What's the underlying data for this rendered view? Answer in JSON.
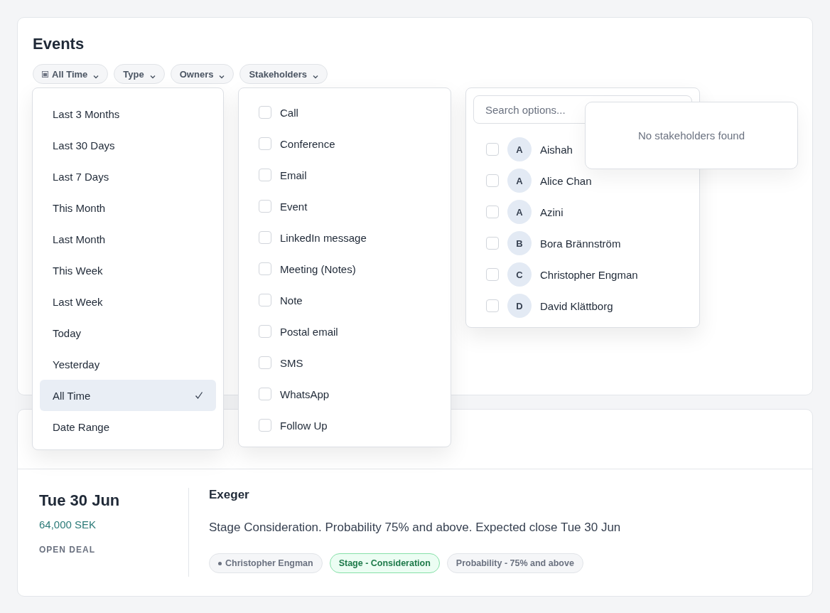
{
  "title": "Events",
  "filters": [
    {
      "label": "All Time",
      "kind": "date"
    },
    {
      "label": "Type",
      "kind": "plain"
    },
    {
      "label": "Owners",
      "kind": "plain"
    },
    {
      "label": "Stakeholders",
      "kind": "plain"
    }
  ],
  "time_menu": {
    "options": [
      {
        "label": "Last 3 Months",
        "selected": false
      },
      {
        "label": "Last 30 Days",
        "selected": false
      },
      {
        "label": "Last 7 Days",
        "selected": false
      },
      {
        "label": "This Month",
        "selected": false
      },
      {
        "label": "Last Month",
        "selected": false
      },
      {
        "label": "This Week",
        "selected": false
      },
      {
        "label": "Last Week",
        "selected": false
      },
      {
        "label": "Today",
        "selected": false
      },
      {
        "label": "Yesterday",
        "selected": false
      },
      {
        "label": "All Time",
        "selected": true
      },
      {
        "label": "Date Range",
        "selected": false
      }
    ]
  },
  "type_menu": {
    "options": [
      {
        "label": "Call",
        "checked": false
      },
      {
        "label": "Conference",
        "checked": false
      },
      {
        "label": "Email",
        "checked": false
      },
      {
        "label": "Event",
        "checked": false
      },
      {
        "label": "LinkedIn message",
        "checked": false
      },
      {
        "label": "Meeting (Notes)",
        "checked": false
      },
      {
        "label": "Note",
        "checked": false
      },
      {
        "label": "Postal email",
        "checked": false
      },
      {
        "label": "SMS",
        "checked": false
      },
      {
        "label": "WhatsApp",
        "checked": false
      },
      {
        "label": "Follow Up",
        "checked": false
      }
    ]
  },
  "stakeholder_menu": {
    "search": {
      "placeholder": "Search options..."
    },
    "options": [
      {
        "initial": "A",
        "name": "Aishah",
        "checked": false
      },
      {
        "initial": "A",
        "name": "Alice Chan",
        "checked": false
      },
      {
        "initial": "A",
        "name": "Azini",
        "checked": false
      },
      {
        "initial": "B",
        "name": "Bora Brännström",
        "checked": false
      },
      {
        "initial": "C",
        "name": "Christopher Engman",
        "checked": false
      },
      {
        "initial": "D",
        "name": "David Klättborg",
        "checked": false
      }
    ]
  },
  "empty_popup": {
    "message": "No stakeholders found"
  },
  "deal": {
    "date": "Tue 30 Jun",
    "amount": "64,000 SEK",
    "status": "OPEN DEAL",
    "company": "Exeger",
    "description": "Stage Consideration. Probability 75% and above. Expected close Tue 30 Jun",
    "tags": [
      {
        "label": "Christopher Engman",
        "kind": "owner"
      },
      {
        "label": "Stage - Consideration",
        "kind": "stage"
      },
      {
        "label": "Probability - 75% and above",
        "kind": "neutral"
      }
    ]
  }
}
